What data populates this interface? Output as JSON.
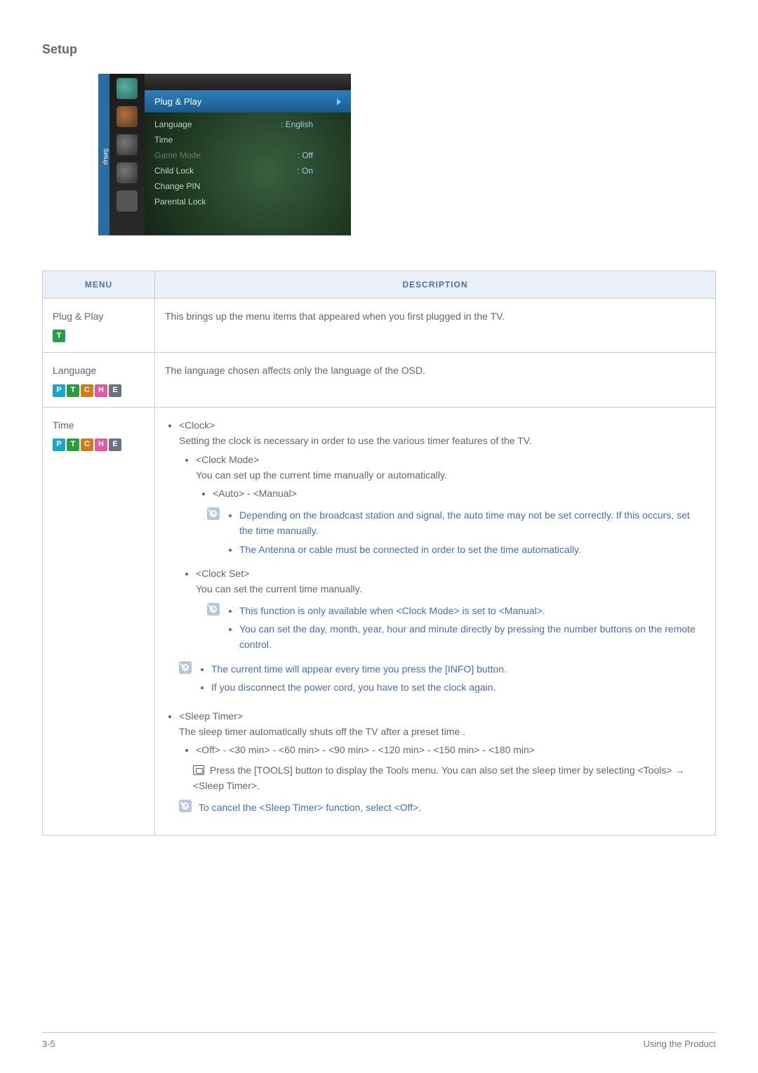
{
  "page_title": "Setup",
  "tv_menu": {
    "side_tab": "Setup",
    "active": "Plug & Play",
    "rows": [
      {
        "label": "Language",
        "value": ": English",
        "dim": false
      },
      {
        "label": "Time",
        "value": "",
        "dim": false
      },
      {
        "label": "Game Mode",
        "value": ": Off",
        "dim": true
      },
      {
        "label": "Child Lock",
        "value": ": On",
        "dim": false
      },
      {
        "label": "Change PIN",
        "value": "",
        "dim": false
      },
      {
        "label": "Parental Lock",
        "value": "",
        "dim": false
      }
    ]
  },
  "table": {
    "head_menu": "MENU",
    "head_desc": "DESCRIPTION",
    "rows": {
      "plug_play": {
        "name": "Plug & Play",
        "badges": [
          "T"
        ],
        "desc": "This brings up the menu items that appeared when you first plugged in the TV."
      },
      "language": {
        "name": "Language",
        "badges": [
          "P",
          "T",
          "C",
          "H",
          "E"
        ],
        "desc": "The language chosen affects only the language of the OSD."
      },
      "time": {
        "name": "Time",
        "badges": [
          "P",
          "T",
          "C",
          "H",
          "E"
        ],
        "clock": {
          "title": "<Clock>",
          "desc": "Setting the clock is necessary in order to use the various timer features of the TV.",
          "mode_title": "<Clock Mode>",
          "mode_desc": "You can set up the current time manually or automatically.",
          "mode_options": "<Auto> - <Manual>",
          "mode_note1": "Depending on the broadcast station and signal, the auto time may not be set correctly. If this occurs, set the time manually.",
          "mode_note2": "The Antenna or cable must be connected in order to set the time automatically.",
          "set_title": "<Clock Set>",
          "set_desc": "You can set the current time manually.",
          "set_note1": "This function is only available when <Clock Mode> is set to <Manual>.",
          "set_note2": "You can set the day, month, year, hour and minute directly by pressing the number buttons on the remote control.",
          "info_note1": "The current time will appear every time you press the [INFO] button.",
          "info_note2": "If you disconnect the power cord, you have to set the clock again."
        },
        "sleep": {
          "title": "<Sleep Timer>",
          "desc": "The sleep timer automatically shuts off the TV after a preset time .",
          "options": "<Off> - <30 min> - <60 min> - <90 min> - <120 min> - <150 min> - <180 min>",
          "tools_note": "Press the [TOOLS] button to display the Tools menu. You can also set the sleep timer by selecting <Tools> → <Sleep Timer>.",
          "cancel_note": "To cancel the <Sleep Timer> function, select <Off>."
        }
      }
    }
  },
  "footer": {
    "left": "3-5",
    "right": "Using the Product"
  }
}
